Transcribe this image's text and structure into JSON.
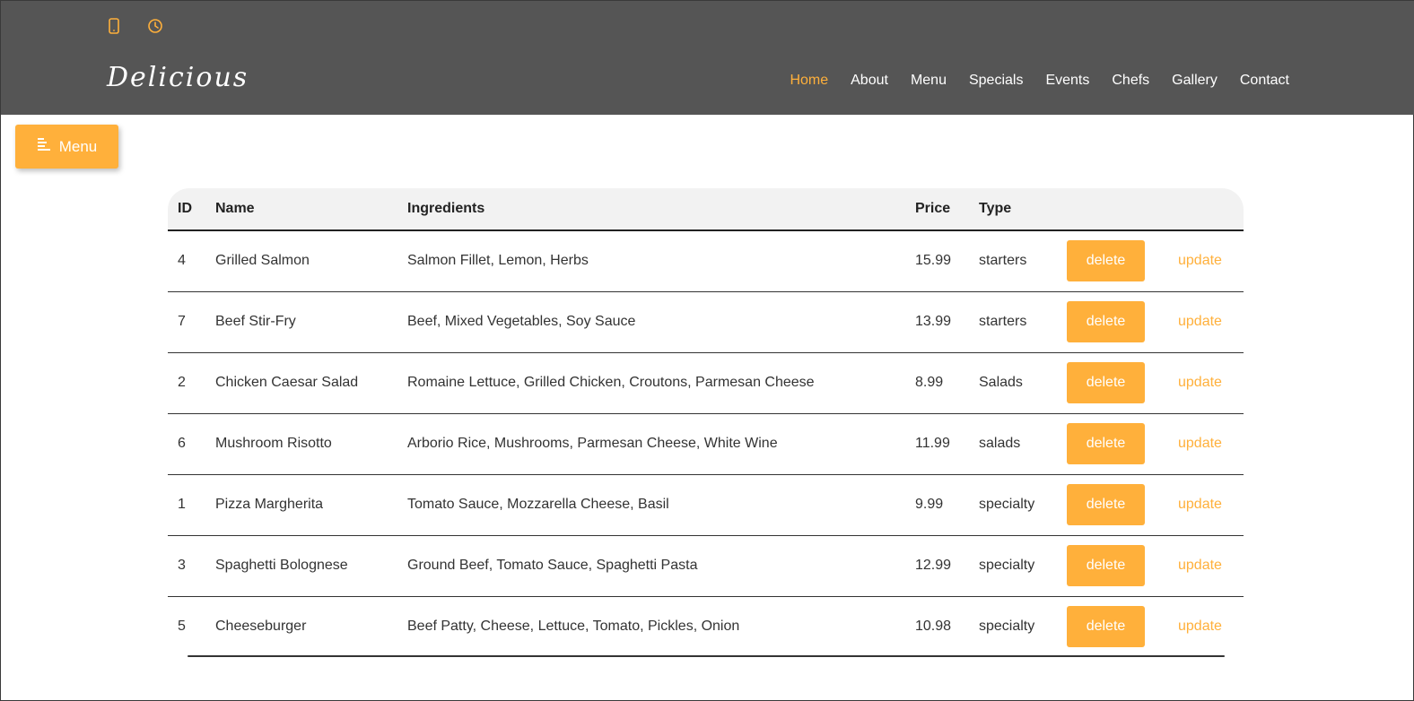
{
  "topbar": {
    "icons": [
      "phone-icon",
      "clock-icon"
    ]
  },
  "brand": {
    "name": "Delicious"
  },
  "nav": {
    "items": [
      {
        "label": "Home",
        "active": true
      },
      {
        "label": "About"
      },
      {
        "label": "Menu"
      },
      {
        "label": "Specials"
      },
      {
        "label": "Events"
      },
      {
        "label": "Chefs"
      },
      {
        "label": "Gallery"
      },
      {
        "label": "Contact"
      }
    ]
  },
  "menu_button": {
    "label": "Menu",
    "icon": "menu-lines-icon"
  },
  "table": {
    "headers": {
      "id": "ID",
      "name": "Name",
      "ingredients": "Ingredients",
      "price": "Price",
      "type": "Type"
    },
    "delete_label": "delete",
    "update_label": "update",
    "rows": [
      {
        "id": "4",
        "name": "Grilled Salmon",
        "ingredients": "Salmon Fillet, Lemon, Herbs",
        "price": "15.99",
        "type": "starters"
      },
      {
        "id": "7",
        "name": "Beef Stir-Fry",
        "ingredients": "Beef, Mixed Vegetables, Soy Sauce",
        "price": "13.99",
        "type": "starters"
      },
      {
        "id": "2",
        "name": "Chicken Caesar Salad",
        "ingredients": "Romaine Lettuce, Grilled Chicken, Croutons, Parmesan Cheese",
        "price": "8.99",
        "type": "Salads"
      },
      {
        "id": "6",
        "name": "Mushroom Risotto",
        "ingredients": "Arborio Rice, Mushrooms, Parmesan Cheese, White Wine",
        "price": "11.99",
        "type": "salads"
      },
      {
        "id": "1",
        "name": "Pizza Margherita",
        "ingredients": "Tomato Sauce, Mozzarella Cheese, Basil",
        "price": "9.99",
        "type": "specialty"
      },
      {
        "id": "3",
        "name": "Spaghetti Bolognese",
        "ingredients": "Ground Beef, Tomato Sauce, Spaghetti Pasta",
        "price": "12.99",
        "type": "specialty"
      },
      {
        "id": "5",
        "name": "Cheeseburger",
        "ingredients": "Beef Patty, Cheese, Lettuce, Tomato, Pickles, Onion",
        "price": "10.98",
        "type": "specialty"
      }
    ]
  },
  "colors": {
    "accent": "#ffb03b",
    "header_bg": "#555555"
  }
}
